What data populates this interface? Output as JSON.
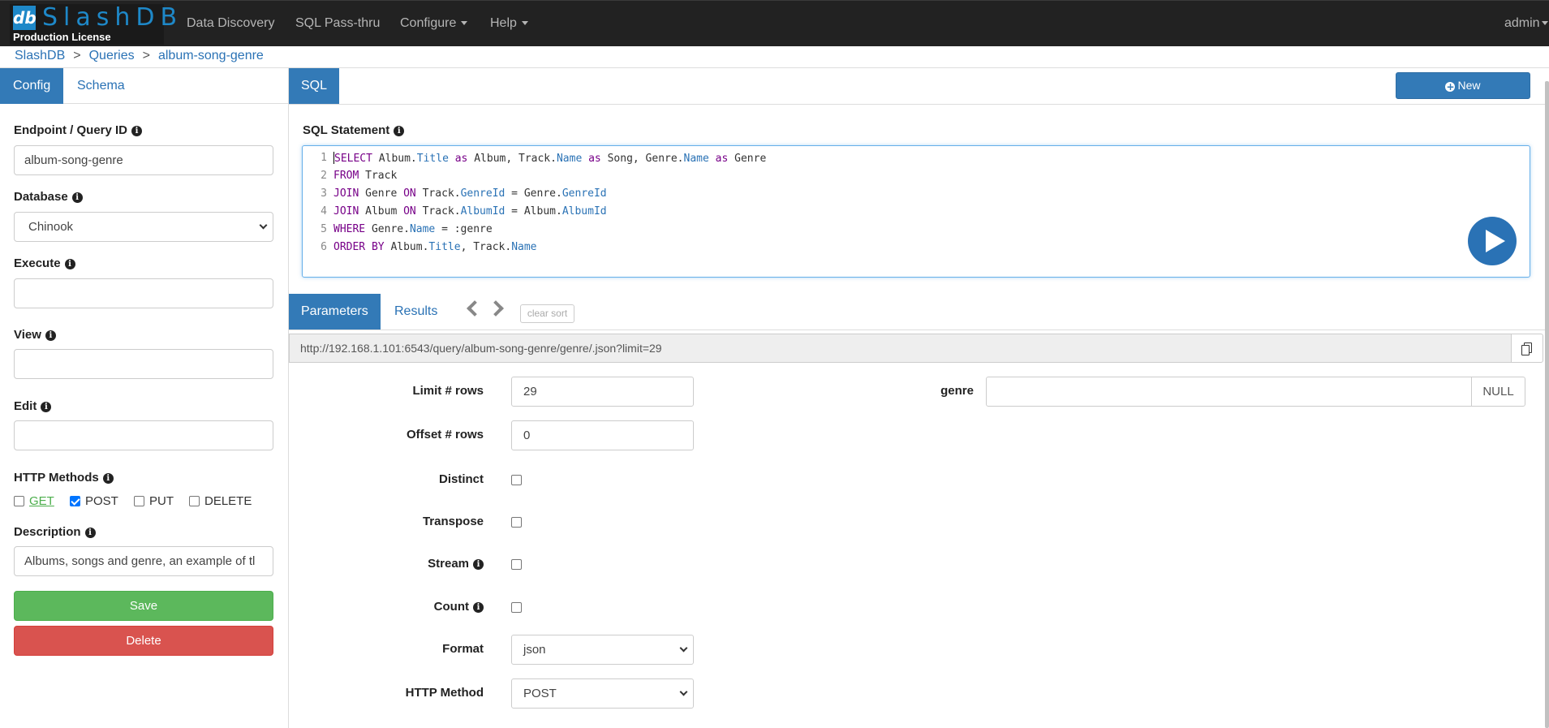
{
  "brand": {
    "name": "SlashDB",
    "logo_text": "db",
    "license": "Production License"
  },
  "nav": {
    "items": [
      "Data Discovery",
      "SQL Pass-thru",
      "Configure",
      "Help"
    ],
    "user": "admin"
  },
  "breadcrumb": [
    "SlashDB",
    "Queries",
    "album-song-genre"
  ],
  "left_panel": {
    "tabs": [
      "Config",
      "Schema"
    ],
    "endpoint_label": "Endpoint / Query ID",
    "endpoint_value": "album-song-genre",
    "database_label": "Database",
    "database_value": "Chinook",
    "execute_label": "Execute",
    "execute_value": "",
    "view_label": "View",
    "view_value": "",
    "edit_label": "Edit",
    "edit_value": "",
    "methods_label": "HTTP Methods",
    "methods": [
      {
        "label": "GET",
        "checked": false
      },
      {
        "label": "POST",
        "checked": true
      },
      {
        "label": "PUT",
        "checked": false
      },
      {
        "label": "DELETE",
        "checked": false
      }
    ],
    "description_label": "Description",
    "description_value": "Albums, songs and genre, an example of tl",
    "save_label": "Save",
    "delete_label": "Delete"
  },
  "sql_panel": {
    "tab": "SQL",
    "new_label": "New",
    "statement_label": "SQL Statement",
    "line_numbers": [
      "1",
      "2",
      "3",
      "4",
      "5",
      "6"
    ],
    "lines": [
      "SELECT Album.Title as Album, Track.Name as Song, Genre.Name as Genre",
      "FROM Track",
      "JOIN Genre ON Track.GenreId = Genre.GenreId",
      "JOIN Album ON Track.AlbumId = Album.AlbumId",
      "WHERE Genre.Name = :genre",
      "ORDER BY Album.Title, Track.Name"
    ]
  },
  "params_panel": {
    "tabs": [
      "Parameters",
      "Results"
    ],
    "clear_sort_label": "clear sort",
    "url": "http://192.168.1.101:6543/query/album-song-genre/genre/.json?limit=29",
    "limit_label": "Limit # rows",
    "limit_value": "29",
    "offset_label": "Offset # rows",
    "offset_value": "0",
    "distinct_label": "Distinct",
    "transpose_label": "Transpose",
    "stream_label": "Stream",
    "count_label": "Count",
    "format_label": "Format",
    "format_value": "json",
    "http_method_label": "HTTP Method",
    "http_method_value": "POST",
    "genre_label": "genre",
    "genre_value": "",
    "null_label": "NULL"
  },
  "colors": {
    "primary": "#337ab7",
    "success": "#5cb85c",
    "danger": "#d9534f",
    "navbar": "#222222",
    "brand": "#1e88c8"
  }
}
